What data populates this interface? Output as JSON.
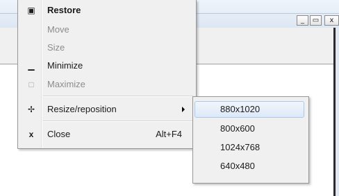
{
  "window": {
    "min_glyph": "_",
    "max_glyph": "▭",
    "close_glyph": "x"
  },
  "menu": {
    "items": [
      {
        "label": "Restore",
        "icon": "▣"
      },
      {
        "label": "Move"
      },
      {
        "label": "Size"
      },
      {
        "label": "Minimize",
        "icon": "▁"
      },
      {
        "label": "Maximize",
        "icon": "□"
      },
      {
        "label": "Resize/reposition",
        "icon": "✢"
      },
      {
        "label": "Close",
        "icon": "x",
        "shortcut": "Alt+F4"
      }
    ]
  },
  "submenu": {
    "items": [
      {
        "label": "880x1020"
      },
      {
        "label": "800x600"
      },
      {
        "label": "1024x768"
      },
      {
        "label": "640x480"
      }
    ]
  },
  "colors": {
    "menu_bg": "#f0f0f0",
    "highlight_border": "#a8c8ef",
    "disabled_text": "#8c8c8c"
  }
}
